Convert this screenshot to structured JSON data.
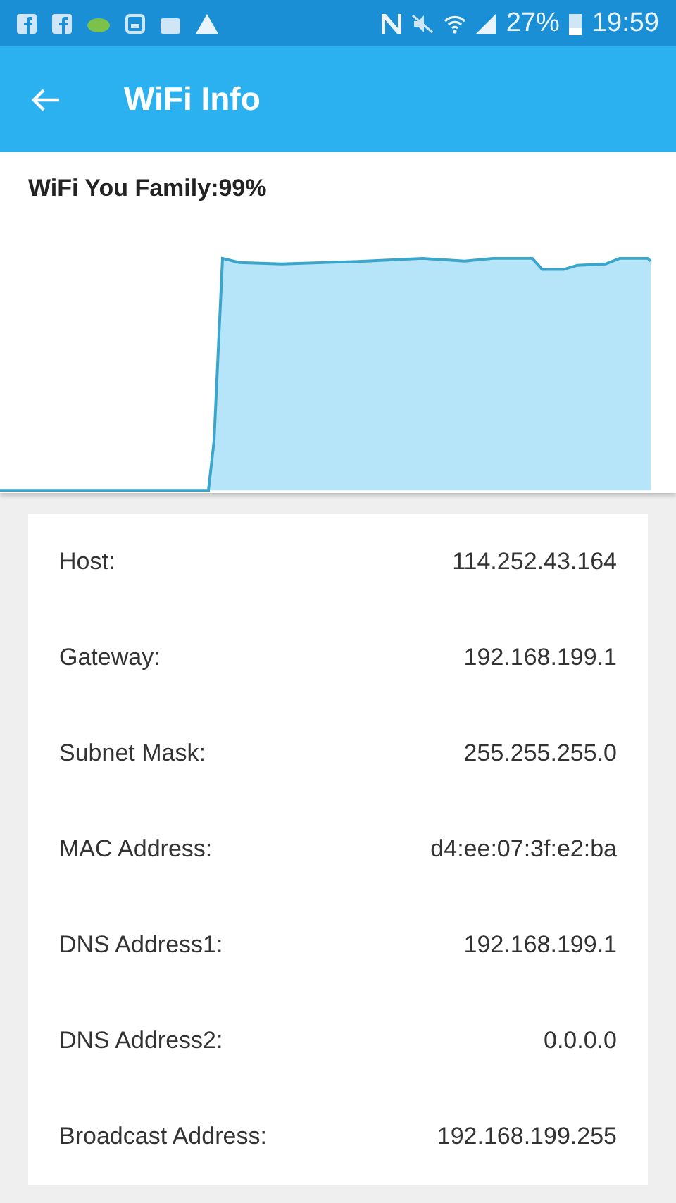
{
  "status_bar": {
    "battery": "27%",
    "time": "19:59"
  },
  "app_bar": {
    "title": "WiFi Info"
  },
  "signal_card": {
    "title": "WiFi You Family:99%"
  },
  "info_rows": [
    {
      "label": "Host:",
      "value": "114.252.43.164"
    },
    {
      "label": "Gateway:",
      "value": "192.168.199.1"
    },
    {
      "label": "Subnet Mask:",
      "value": "255.255.255.0"
    },
    {
      "label": "MAC Address:",
      "value": "d4:ee:07:3f:e2:ba"
    },
    {
      "label": "DNS Address1:",
      "value": "192.168.199.1"
    },
    {
      "label": "DNS Address2:",
      "value": "0.0.0.0"
    },
    {
      "label": "Broadcast Address:",
      "value": "192.168.199.255"
    }
  ]
}
